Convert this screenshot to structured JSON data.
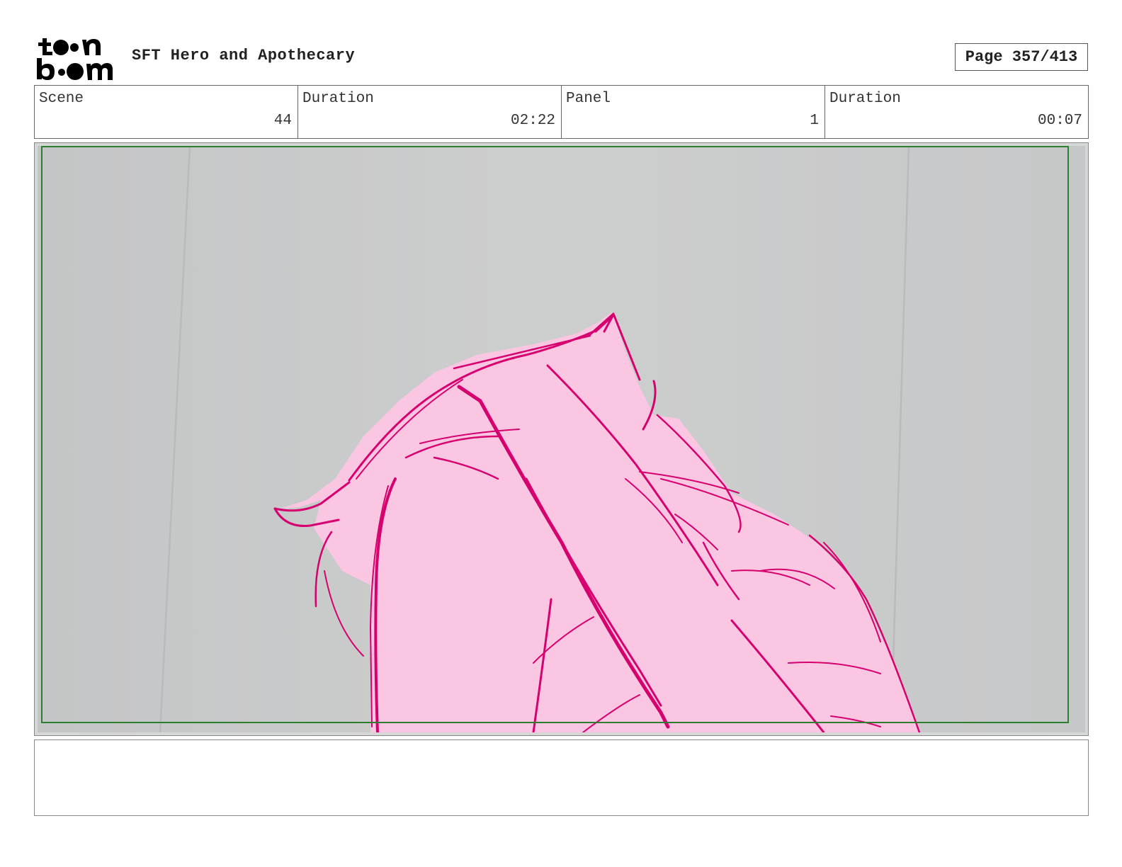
{
  "header": {
    "logo_text_top": "toon",
    "logo_text_bottom": "boom",
    "title": "SFT Hero and Apothecary",
    "page_label": "Page 357/413"
  },
  "info": {
    "scene_label": "Scene",
    "scene_value": "44",
    "scene_duration_label": "Duration",
    "scene_duration_value": "02:22",
    "panel_label": "Panel",
    "panel_value": "1",
    "panel_duration_label": "Duration",
    "panel_duration_value": "00:07"
  },
  "colors": {
    "sketch_line": "#d6006f",
    "sketch_fill": "#fbc6e2",
    "background": "#c9cacb",
    "safe_frame": "#2f7d2f"
  },
  "notes": {
    "text": ""
  }
}
